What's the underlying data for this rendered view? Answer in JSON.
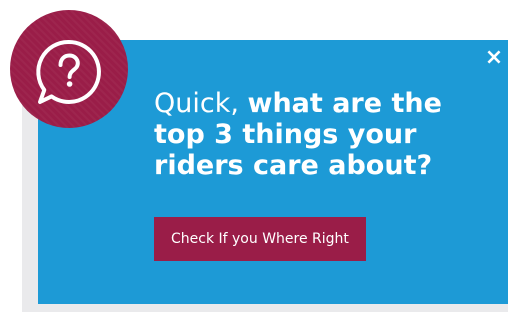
{
  "modal": {
    "headline_light": "Quick, ",
    "headline_bold": "what are the top 3 things your riders care about?",
    "cta_label": "Check If you Where Right",
    "close_label": "×",
    "icon": "question-speech-bubble-icon"
  },
  "colors": {
    "modal_background": "#1d9ad6",
    "accent": "#9a1d48",
    "text": "#ffffff",
    "backdrop_card": "#eaeaec"
  }
}
